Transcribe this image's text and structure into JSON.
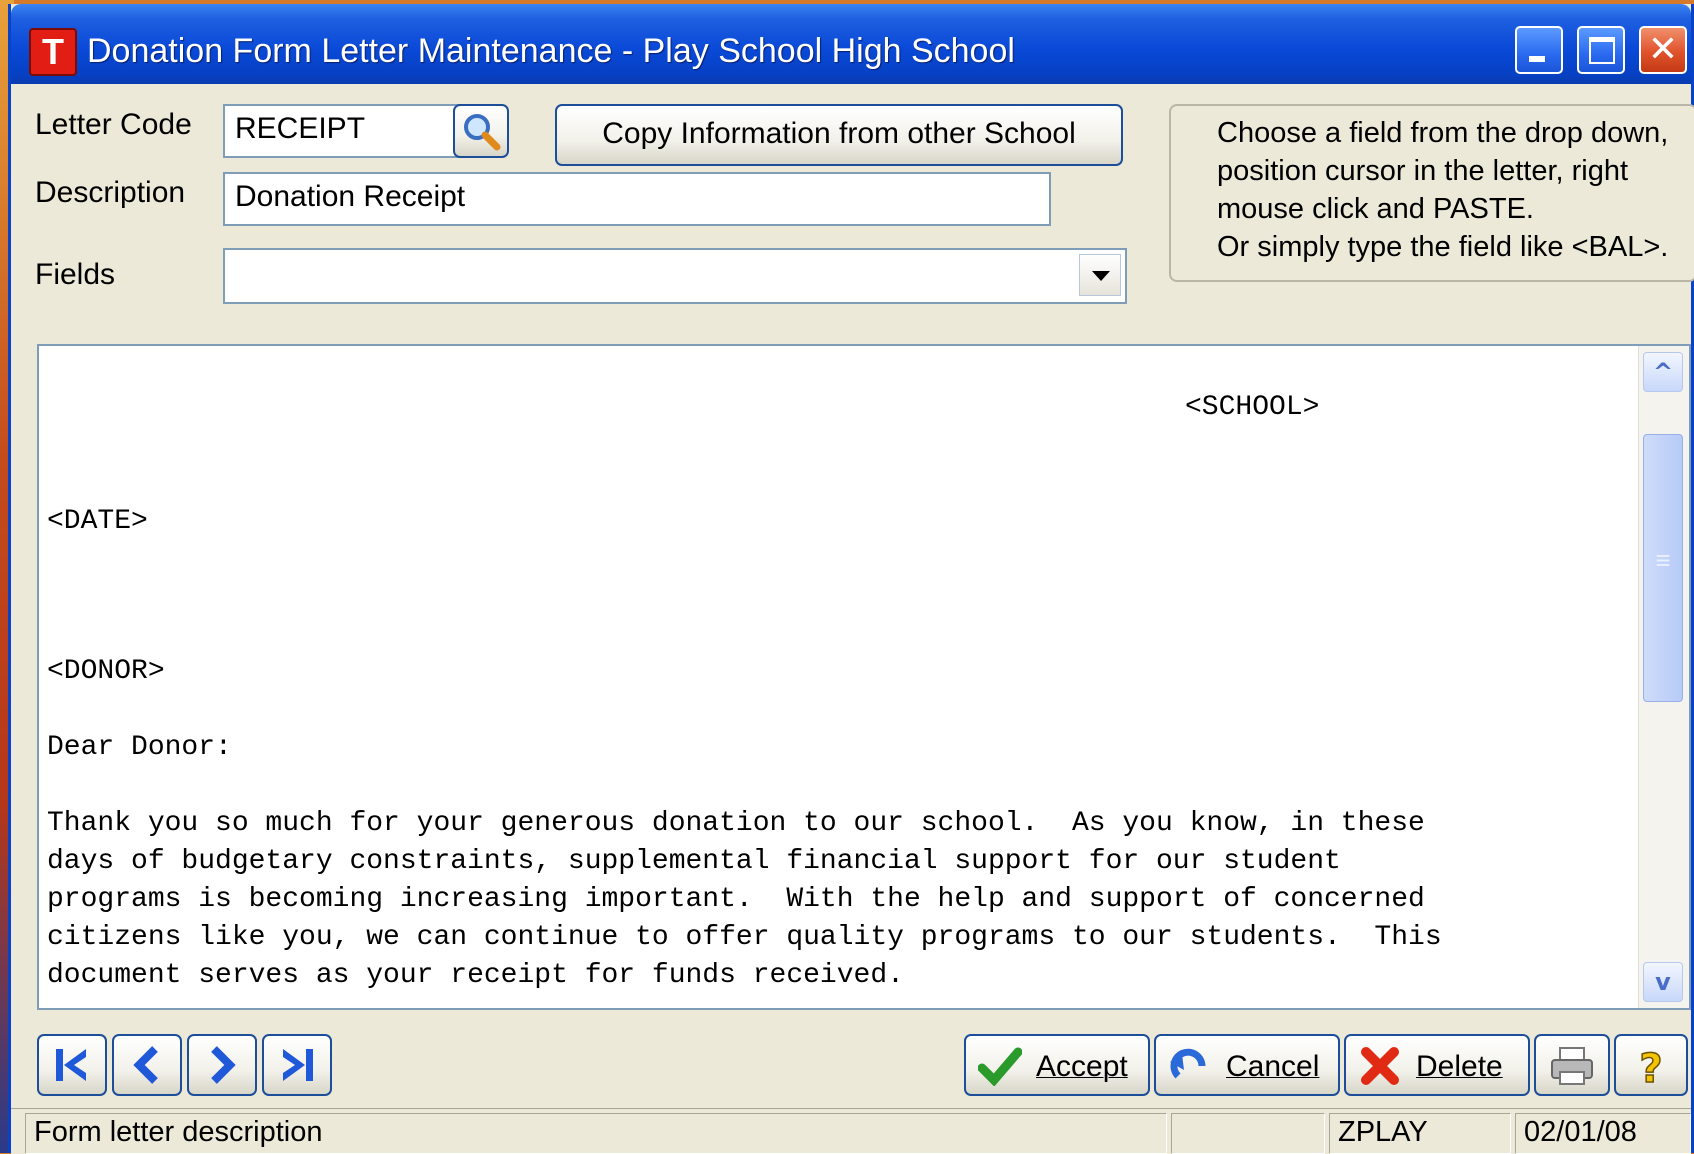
{
  "window": {
    "title": "Donation Form Letter Maintenance - Play School High School",
    "icon_letter": "T"
  },
  "form": {
    "letter_code_label": "Letter Code",
    "letter_code_value": "RECEIPT",
    "description_label": "Description",
    "description_value": "Donation Receipt",
    "fields_label": "Fields",
    "fields_value": "",
    "copy_button_label": "Copy Information from other School"
  },
  "help": {
    "lines": [
      "Choose a field from the drop down,",
      "position  cursor  in  the  letter, right",
      "mouse click and PASTE.",
      "Or simply type the field like <BAL>."
    ]
  },
  "letter": {
    "school": "<SCHOOL>",
    "date": "<DATE>",
    "donor": "<DONOR>",
    "salutation": "Dear Donor:",
    "body": [
      "Thank you so much for your generous donation to our school.  As you know, in these",
      "days of budgetary constraints, supplemental financial support for our student",
      "programs is becoming increasing important.  With the help and support of concerned",
      "citizens like you, we can continue to offer quality programs to our students.  This",
      "document serves as your receipt for funds received."
    ]
  },
  "actions": {
    "accept": "Accept",
    "cancel": "Cancel",
    "delete": "Delete"
  },
  "status": {
    "message": "Form letter description",
    "panel2": "",
    "user": "ZPLAY",
    "date": "02/01/08"
  },
  "icons": [
    "search-icon",
    "first-record-icon",
    "previous-record-icon",
    "next-record-icon",
    "last-record-icon",
    "checkmark-icon",
    "undo-icon",
    "delete-x-icon",
    "printer-icon",
    "help-question-icon"
  ],
  "colors": {
    "title_bar": "#0a4ad8",
    "window_bg": "#ece9d8",
    "button_border": "#1d4e9a",
    "nav_arrow": "#1f58d8"
  }
}
